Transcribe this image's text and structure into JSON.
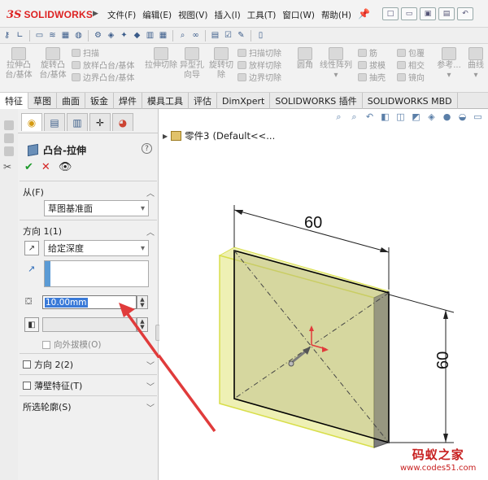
{
  "app": {
    "brand_ds": "3S",
    "brand_name": "SOLIDWORKS"
  },
  "menu": [
    "文件(F)",
    "编辑(E)",
    "视图(V)",
    "插入(I)",
    "工具(T)",
    "窗口(W)",
    "帮助(H)"
  ],
  "ribbon": {
    "big": [
      "拉伸凸台/基体",
      "旋转凸台/基体",
      "拉伸切除",
      "异型孔向导",
      "旋转切除",
      "圆角",
      "线性阵列",
      "筋",
      "参考...",
      "曲线"
    ],
    "small": [
      "扫描",
      "放样凸台/基体",
      "边界凸台/基体",
      "扫描切除",
      "放样切除",
      "边界切除",
      "拔模",
      "抽壳",
      "包覆",
      "相交",
      "镜向"
    ]
  },
  "tabs": [
    "特征",
    "草图",
    "曲面",
    "钣金",
    "焊件",
    "模具工具",
    "评估",
    "DimXpert",
    "SOLIDWORKS 插件",
    "SOLIDWORKS MBD"
  ],
  "active_tab": "特征",
  "property_manager": {
    "title": "凸台-拉伸",
    "help": "?",
    "from": {
      "label": "从(F)",
      "value": "草图基准面"
    },
    "direction1": {
      "label": "方向 1(1)",
      "end_condition": "给定深度",
      "depth": "10.00mm",
      "draft_outward": "向外拔模(O)"
    },
    "direction2": {
      "label": "方向 2(2)"
    },
    "thin_feature": {
      "label": "薄壁特征(T)"
    },
    "selected_contours": {
      "label": "所选轮廓(S)"
    }
  },
  "feature_tree": {
    "node": "零件3",
    "config": "(Default<<..."
  },
  "dimensions": {
    "top": "60",
    "side": "60"
  },
  "watermark": {
    "line1": "码蚁之家",
    "line2": "www.codes51.com"
  },
  "colors": {
    "extrude_face": "#eef0b4",
    "extrude_edge": "#d8de4a",
    "accent_blue": "#5b9bd5",
    "arrow_red": "#e03b3b"
  }
}
